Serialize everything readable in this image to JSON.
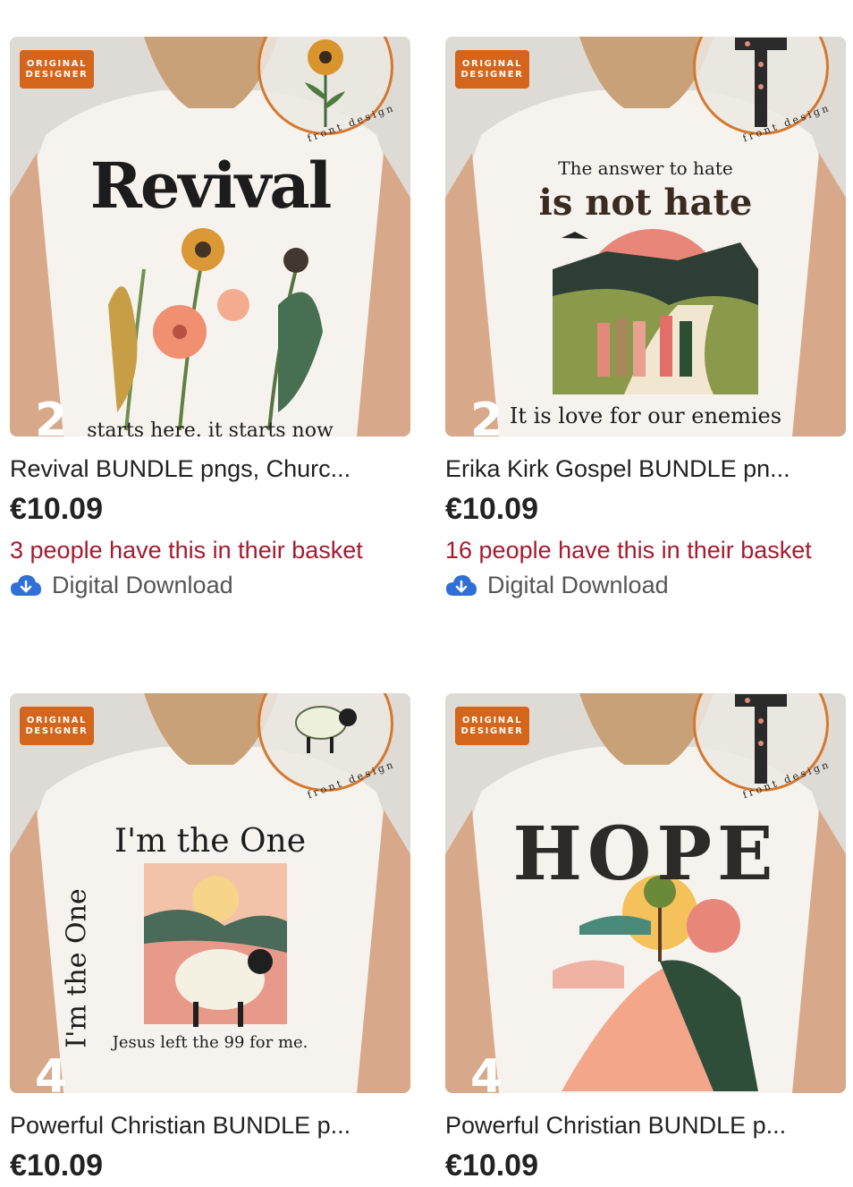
{
  "products": [
    {
      "badge_line1": "ORIGINAL",
      "badge_line2": "DESIGNER",
      "front_label": "front design",
      "image_count": "2",
      "design_heading": "Revival",
      "design_footer": "starts here. it starts now",
      "title": "Revival BUNDLE pngs, Churc...",
      "price": "€10.09",
      "basket_text": "3 people have this in their basket",
      "download_label": "Digital Download",
      "download_icon": "cloud-download-icon"
    },
    {
      "badge_line1": "ORIGINAL",
      "badge_line2": "DESIGNER",
      "front_label": "front design",
      "image_count": "2",
      "design_heading": "The answer to hate",
      "design_heading2": "is not hate",
      "design_footer": "It is love for our enemies",
      "title": "Erika Kirk Gospel BUNDLE pn...",
      "price": "€10.09",
      "basket_text": "16 people have this in their basket",
      "download_label": "Digital Download",
      "download_icon": "cloud-download-icon"
    },
    {
      "badge_line1": "ORIGINAL",
      "badge_line2": "DESIGNER",
      "front_label": "front design",
      "image_count": "4",
      "design_heading": "I'm the One",
      "design_side": "I'm the One",
      "design_footer": "Jesus left the 99 for me.",
      "title": "Powerful Christian BUNDLE p...",
      "price": "€10.09"
    },
    {
      "badge_line1": "ORIGINAL",
      "badge_line2": "DESIGNER",
      "front_label": "front design",
      "image_count": "4",
      "design_heading": "HOPE",
      "title": "Powerful Christian BUNDLE p...",
      "price": "€10.09"
    }
  ],
  "colors": {
    "badge": "#d4651c",
    "basket_text": "#a61a2e",
    "download_icon": "#2f6fd6"
  }
}
